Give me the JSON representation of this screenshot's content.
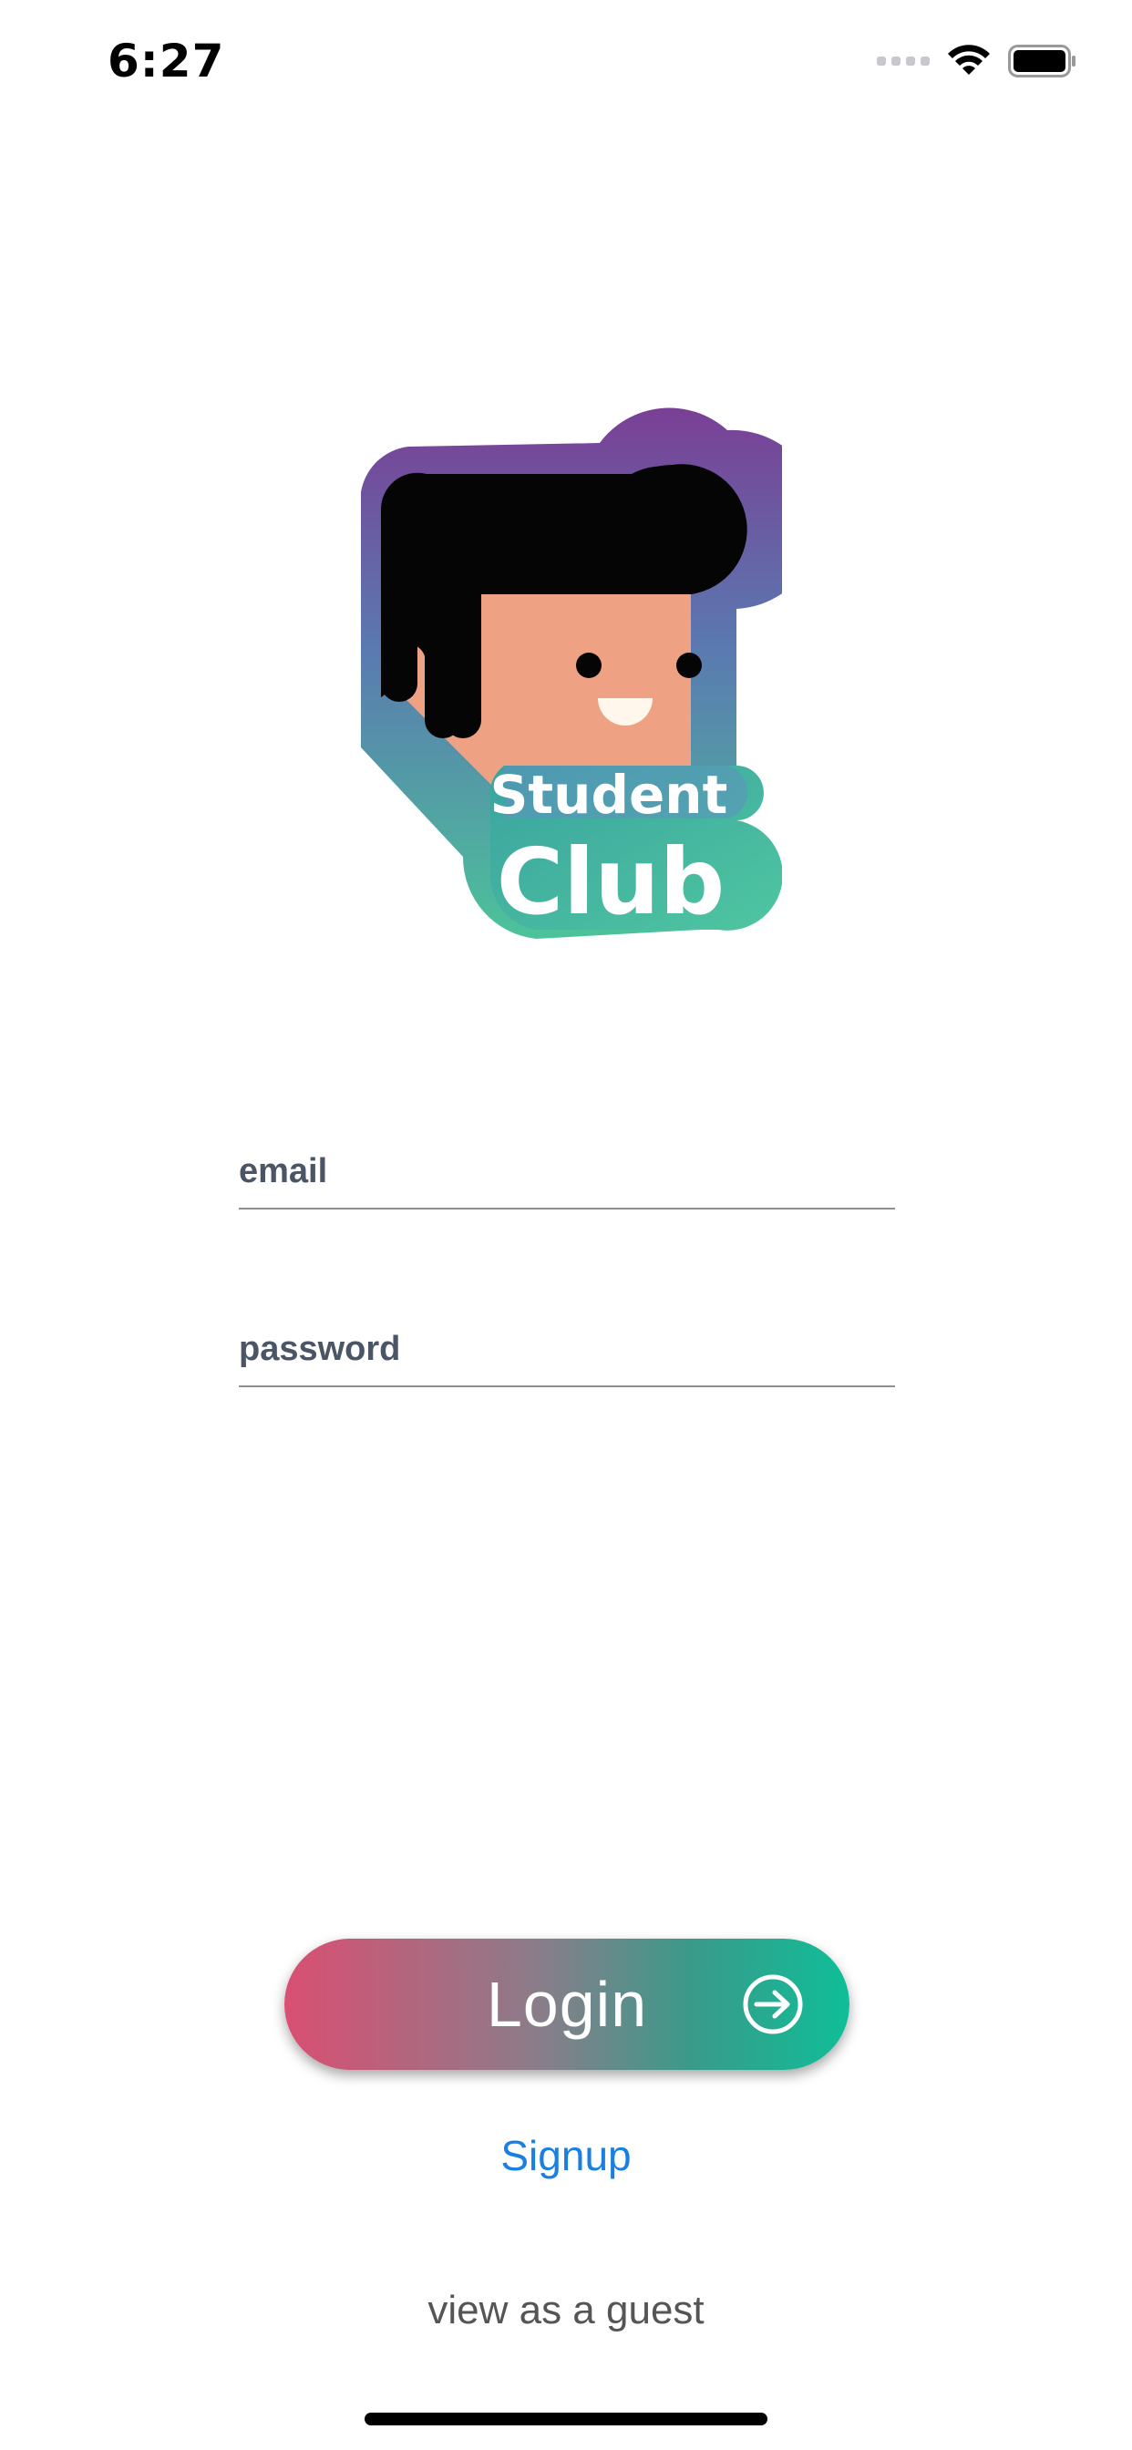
{
  "status_bar": {
    "time": "6:27"
  },
  "logo": {
    "line1": "Student",
    "line2": "Club"
  },
  "form": {
    "email_placeholder": "email",
    "password_placeholder": "password"
  },
  "actions": {
    "login_label": "Login",
    "signup_label": "Signup",
    "guest_label": "view as a guest"
  },
  "colors": {
    "signup_link": "#1a7fe0",
    "login_gradient_start": "#d94f72",
    "login_gradient_end": "#0fbe98",
    "logo_border_top": "#7a3f96",
    "logo_border_bottom": "#4cc39a"
  },
  "icons": {
    "wifi": "wifi-icon",
    "battery": "battery-icon",
    "login": "arrow-right-circle-icon"
  }
}
